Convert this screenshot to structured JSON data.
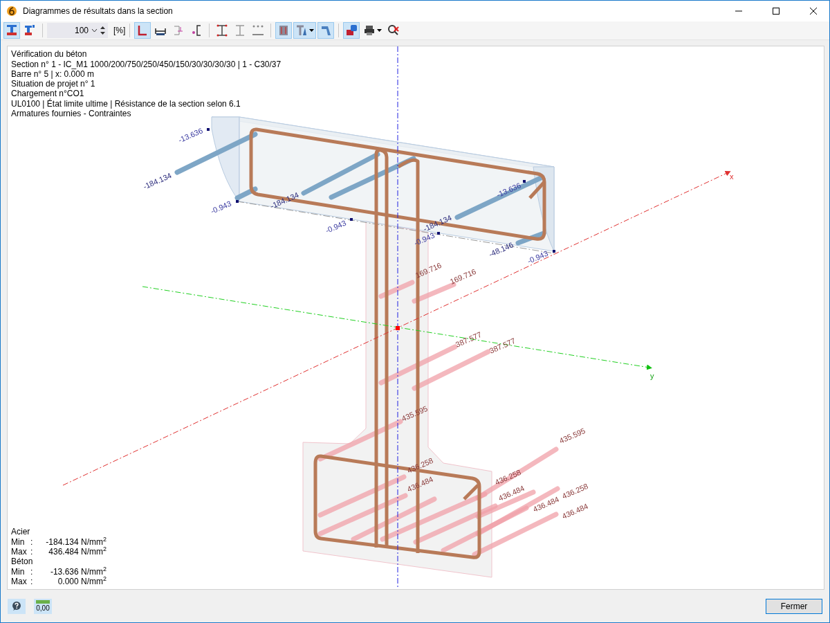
{
  "window": {
    "title": "Diagrammes de résultats dans la section"
  },
  "toolbar": {
    "zoom_value": "100",
    "zoom_unit": "[%]",
    "buttons": [
      {
        "selected": true
      },
      {
        "selected": false
      },
      {
        "selected": true
      },
      {
        "selected": false
      },
      {
        "selected": false
      },
      {
        "selected": false
      },
      {
        "selected": false
      },
      {
        "selected": false
      },
      {
        "selected": false
      },
      {
        "selected": true
      },
      {
        "selected": true
      },
      {
        "selected": true
      },
      {
        "selected": true
      },
      {
        "selected": false
      },
      {
        "selected": false
      }
    ]
  },
  "info_lines": [
    "Vérification du béton",
    "Section n° 1 - IC_M1 1000/200/750/250/450/150/30/30/30/30 | 1 - C30/37",
    "Barre n° 5 | x: 0.000 m",
    "Situation de projet n° 1",
    "Chargement n°CO1",
    "UL0100 | État limite ultime | Résistance de la section selon 6.1",
    "Armatures fournies - Contraintes"
  ],
  "stress_labels": [
    {
      "text": "-13.636",
      "kind": "concrete"
    },
    {
      "text": "-184.134",
      "kind": "compression"
    },
    {
      "text": "-0.943",
      "kind": "concrete"
    },
    {
      "text": "-184.134",
      "kind": "compression"
    },
    {
      "text": "-0.943",
      "kind": "concrete"
    },
    {
      "text": "-184.134",
      "kind": "compression"
    },
    {
      "text": "-0.943",
      "kind": "concrete"
    },
    {
      "text": "-13.636",
      "kind": "concrete"
    },
    {
      "text": "-48.146",
      "kind": "compression"
    },
    {
      "text": "-0.943",
      "kind": "concrete"
    },
    {
      "text": "169.716",
      "kind": "tension"
    },
    {
      "text": "169.716",
      "kind": "tension"
    },
    {
      "text": "387.577",
      "kind": "tension"
    },
    {
      "text": "387.577",
      "kind": "tension"
    },
    {
      "text": "435.595",
      "kind": "tension"
    },
    {
      "text": "435.595",
      "kind": "tension"
    },
    {
      "text": "436.258",
      "kind": "tension"
    },
    {
      "text": "436.484",
      "kind": "tension"
    },
    {
      "text": "436.258",
      "kind": "tension"
    },
    {
      "text": "436.484",
      "kind": "tension"
    },
    {
      "text": "436.258",
      "kind": "tension"
    },
    {
      "text": "436.484",
      "kind": "tension"
    },
    {
      "text": "436.484",
      "kind": "tension"
    }
  ],
  "axes": {
    "x_label": "x",
    "y_label": "y"
  },
  "results": [
    {
      "title": "Acier",
      "rows": [
        {
          "label": "Min",
          "colon": ":",
          "value": "-184.134 N/mm$^{2}$"
        },
        {
          "label": "Max",
          "colon": ":",
          "value": "436.484 N/mm$^{2}$"
        }
      ]
    },
    {
      "title": "Béton",
      "rows": [
        {
          "label": "Min",
          "colon": ":",
          "value": "-13.636 N/mm$^{2}$"
        },
        {
          "label": "Max",
          "colon": ":",
          "value": "0.000 N/mm$^{2}$"
        }
      ]
    }
  ],
  "footer": {
    "decimals_label": "0,00",
    "close_button": "Fermer"
  }
}
